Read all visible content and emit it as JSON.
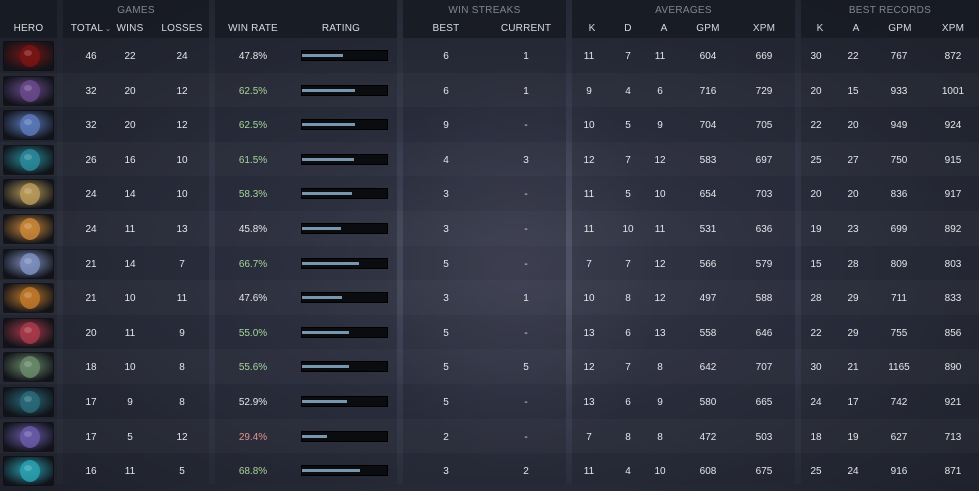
{
  "groups": {
    "games": "GAMES",
    "win_streaks": "WIN STREAKS",
    "averages": "AVERAGES",
    "best_records": "BEST RECORDS"
  },
  "columns": {
    "hero": "HERO",
    "total": "TOTAL",
    "total_sort": "⌄",
    "wins": "WINS",
    "losses": "LOSSES",
    "winrate": "WIN RATE",
    "rating": "RATING",
    "best": "BEST",
    "current": "CURRENT",
    "avg_k": "K",
    "avg_d": "D",
    "avg_a": "A",
    "avg_gpm": "GPM",
    "avg_xpm": "XPM",
    "best_k": "K",
    "best_a": "A",
    "best_gpm": "GPM",
    "best_xpm": "XPM"
  },
  "rows": [
    {
      "hero_icon": "hero-portrait-icon",
      "hero_color": "#7a1414",
      "total": "46",
      "wins": "22",
      "losses": "24",
      "winrate": "47.8%",
      "rating": 0.478,
      "best": "6",
      "current": "1",
      "k": "11",
      "d": "7",
      "a": "11",
      "gpm": "604",
      "xpm": "669",
      "bk": "30",
      "ba": "22",
      "bgpm": "767",
      "bxpm": "872"
    },
    {
      "hero_icon": "hero-portrait-icon",
      "hero_color": "#6a4a8c",
      "total": "32",
      "wins": "20",
      "losses": "12",
      "winrate": "62.5%",
      "rating": 0.625,
      "best": "6",
      "current": "1",
      "k": "9",
      "d": "4",
      "a": "6",
      "gpm": "716",
      "xpm": "729",
      "bk": "20",
      "ba": "15",
      "bgpm": "933",
      "bxpm": "1001"
    },
    {
      "hero_icon": "hero-portrait-icon",
      "hero_color": "#5a78b8",
      "total": "32",
      "wins": "20",
      "losses": "12",
      "winrate": "62.5%",
      "rating": 0.625,
      "best": "9",
      "current": "-",
      "k": "10",
      "d": "5",
      "a": "9",
      "gpm": "704",
      "xpm": "705",
      "bk": "22",
      "ba": "20",
      "bgpm": "949",
      "bxpm": "924"
    },
    {
      "hero_icon": "hero-portrait-icon",
      "hero_color": "#2a8a9a",
      "total": "26",
      "wins": "16",
      "losses": "10",
      "winrate": "61.5%",
      "rating": 0.615,
      "best": "4",
      "current": "3",
      "k": "12",
      "d": "7",
      "a": "12",
      "gpm": "583",
      "xpm": "697",
      "bk": "25",
      "ba": "27",
      "bgpm": "750",
      "bxpm": "915"
    },
    {
      "hero_icon": "hero-portrait-icon",
      "hero_color": "#b89a5a",
      "total": "24",
      "wins": "14",
      "losses": "10",
      "winrate": "58.3%",
      "rating": 0.583,
      "best": "3",
      "current": "-",
      "k": "11",
      "d": "5",
      "a": "10",
      "gpm": "654",
      "xpm": "703",
      "bk": "20",
      "ba": "20",
      "bgpm": "836",
      "bxpm": "917"
    },
    {
      "hero_icon": "hero-portrait-icon",
      "hero_color": "#c8863a",
      "total": "24",
      "wins": "11",
      "losses": "13",
      "winrate": "45.8%",
      "rating": 0.458,
      "best": "3",
      "current": "-",
      "k": "11",
      "d": "10",
      "a": "11",
      "gpm": "531",
      "xpm": "636",
      "bk": "19",
      "ba": "23",
      "bgpm": "699",
      "bxpm": "892"
    },
    {
      "hero_icon": "hero-portrait-icon",
      "hero_color": "#7f8fbf",
      "total": "21",
      "wins": "14",
      "losses": "7",
      "winrate": "66.7%",
      "rating": 0.667,
      "best": "5",
      "current": "-",
      "k": "7",
      "d": "7",
      "a": "12",
      "gpm": "566",
      "xpm": "579",
      "bk": "15",
      "ba": "28",
      "bgpm": "809",
      "bxpm": "803"
    },
    {
      "hero_icon": "hero-portrait-icon",
      "hero_color": "#c0782a",
      "total": "21",
      "wins": "10",
      "losses": "11",
      "winrate": "47.6%",
      "rating": 0.476,
      "best": "3",
      "current": "1",
      "k": "10",
      "d": "8",
      "a": "12",
      "gpm": "497",
      "xpm": "588",
      "bk": "28",
      "ba": "29",
      "bgpm": "711",
      "bxpm": "833"
    },
    {
      "hero_icon": "hero-portrait-icon",
      "hero_color": "#a83a4a",
      "total": "20",
      "wins": "11",
      "losses": "9",
      "winrate": "55.0%",
      "rating": 0.55,
      "best": "5",
      "current": "-",
      "k": "13",
      "d": "6",
      "a": "13",
      "gpm": "558",
      "xpm": "646",
      "bk": "22",
      "ba": "29",
      "bgpm": "755",
      "bxpm": "856"
    },
    {
      "hero_icon": "hero-portrait-icon",
      "hero_color": "#6a8a6a",
      "total": "18",
      "wins": "10",
      "losses": "8",
      "winrate": "55.6%",
      "rating": 0.556,
      "best": "5",
      "current": "5",
      "k": "12",
      "d": "7",
      "a": "8",
      "gpm": "642",
      "xpm": "707",
      "bk": "30",
      "ba": "21",
      "bgpm": "1165",
      "bxpm": "890"
    },
    {
      "hero_icon": "hero-portrait-icon",
      "hero_color": "#2a6a7a",
      "total": "17",
      "wins": "9",
      "losses": "8",
      "winrate": "52.9%",
      "rating": 0.529,
      "best": "5",
      "current": "-",
      "k": "13",
      "d": "6",
      "a": "9",
      "gpm": "580",
      "xpm": "665",
      "bk": "24",
      "ba": "17",
      "bgpm": "742",
      "bxpm": "921"
    },
    {
      "hero_icon": "hero-portrait-icon",
      "hero_color": "#6a5aa8",
      "total": "17",
      "wins": "5",
      "losses": "12",
      "winrate": "29.4%",
      "rating": 0.294,
      "best": "2",
      "current": "-",
      "k": "7",
      "d": "8",
      "a": "8",
      "gpm": "472",
      "xpm": "503",
      "bk": "18",
      "ba": "19",
      "bgpm": "627",
      "bxpm": "713"
    },
    {
      "hero_icon": "hero-portrait-icon",
      "hero_color": "#2aa0b0",
      "total": "16",
      "wins": "11",
      "losses": "5",
      "winrate": "68.8%",
      "rating": 0.688,
      "best": "3",
      "current": "2",
      "k": "11",
      "d": "4",
      "a": "10",
      "gpm": "608",
      "xpm": "675",
      "bk": "25",
      "ba": "24",
      "bgpm": "916",
      "bxpm": "871"
    }
  ],
  "colors": {
    "winrate_high": "#a6d49a",
    "winrate_low": "#e0958f",
    "rating_fill": "#7896ae"
  }
}
